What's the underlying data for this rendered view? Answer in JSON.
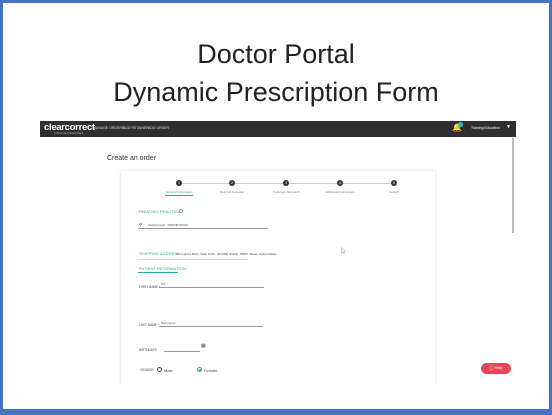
{
  "slide": {
    "title_line1": "Doctor Portal",
    "title_line2": "Dynamic Prescription  Form",
    "border_color": "#4472c4"
  },
  "app": {
    "logo": "clearcorrect",
    "logo_sub": "A Straumann Group brand",
    "nav": [
      "MANAGE ORDERS",
      "ADD RETAINER",
      "ADD ORDER"
    ],
    "user": "Training Education",
    "notification_icon": "bell-icon",
    "page_title": "Create an order",
    "steps": [
      {
        "num": "1",
        "label": "General Information",
        "active": true
      },
      {
        "num": "2",
        "label": "Records Uploader",
        "active": false
      },
      {
        "num": "3",
        "label": "Treatment Approach",
        "active": false
      },
      {
        "num": "4",
        "label": "Additional Instructions",
        "active": false
      },
      {
        "num": "5",
        "label": "Submit",
        "active": false
      }
    ],
    "treating_practice_label": "TREATING PRACTICE",
    "treating_practice_value": "ClearCorrect - ROUND ROCK",
    "shipping_label": "SHIPPING ADDRESS",
    "shipping_value": "21 Cypress Blvd., Suite 1010., ROUND ROCK, 78665, Texas, United States",
    "patient_info_label": "PATIENT INFORMATION",
    "first_name_label": "FIRST NAME *",
    "first_name_value": "CX",
    "last_name_label": "LAST NAME *",
    "last_name_value": "Summoner",
    "birthdate_label": "BIRTHDATE",
    "gender_label": "GENDER",
    "gender_options": [
      "Male",
      "Female"
    ],
    "gender_selected": "Female",
    "help_button": "Help",
    "accent_color": "#2aa6a6",
    "help_color": "#e8455a"
  }
}
